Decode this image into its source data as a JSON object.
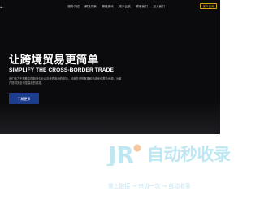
{
  "nav": {
    "logo": "AL",
    "items": [
      "服务介绍",
      "解决方案",
      "跨境资讯",
      "关于云航",
      "联系我们",
      "加入我们"
    ],
    "contact_label": "客户咨询"
  },
  "hero": {
    "title": "让跨境贸易更简单",
    "subtitle": "SIMPLIFY THE CROSS-BORDER TRADE",
    "description": "我们致力于帮助中国制造企业走向世界各地的市场，利用先进的数据和系统优化整合资源，为客户提供安全可靠高效的服务。",
    "cta_label": "了解更多"
  },
  "watermark": {
    "title": "自动秒收录",
    "subtitle": "做上链接 → 来访一次 → 自动收录",
    "logo_text": "JR",
    "colors": {
      "primary": "#bfe7f2",
      "accent": "#f5c6a0"
    }
  },
  "colors": {
    "hero_bg": "#0b0b0d",
    "cta_bg": "#1d3d8f",
    "contact_border": "#d4a017"
  }
}
